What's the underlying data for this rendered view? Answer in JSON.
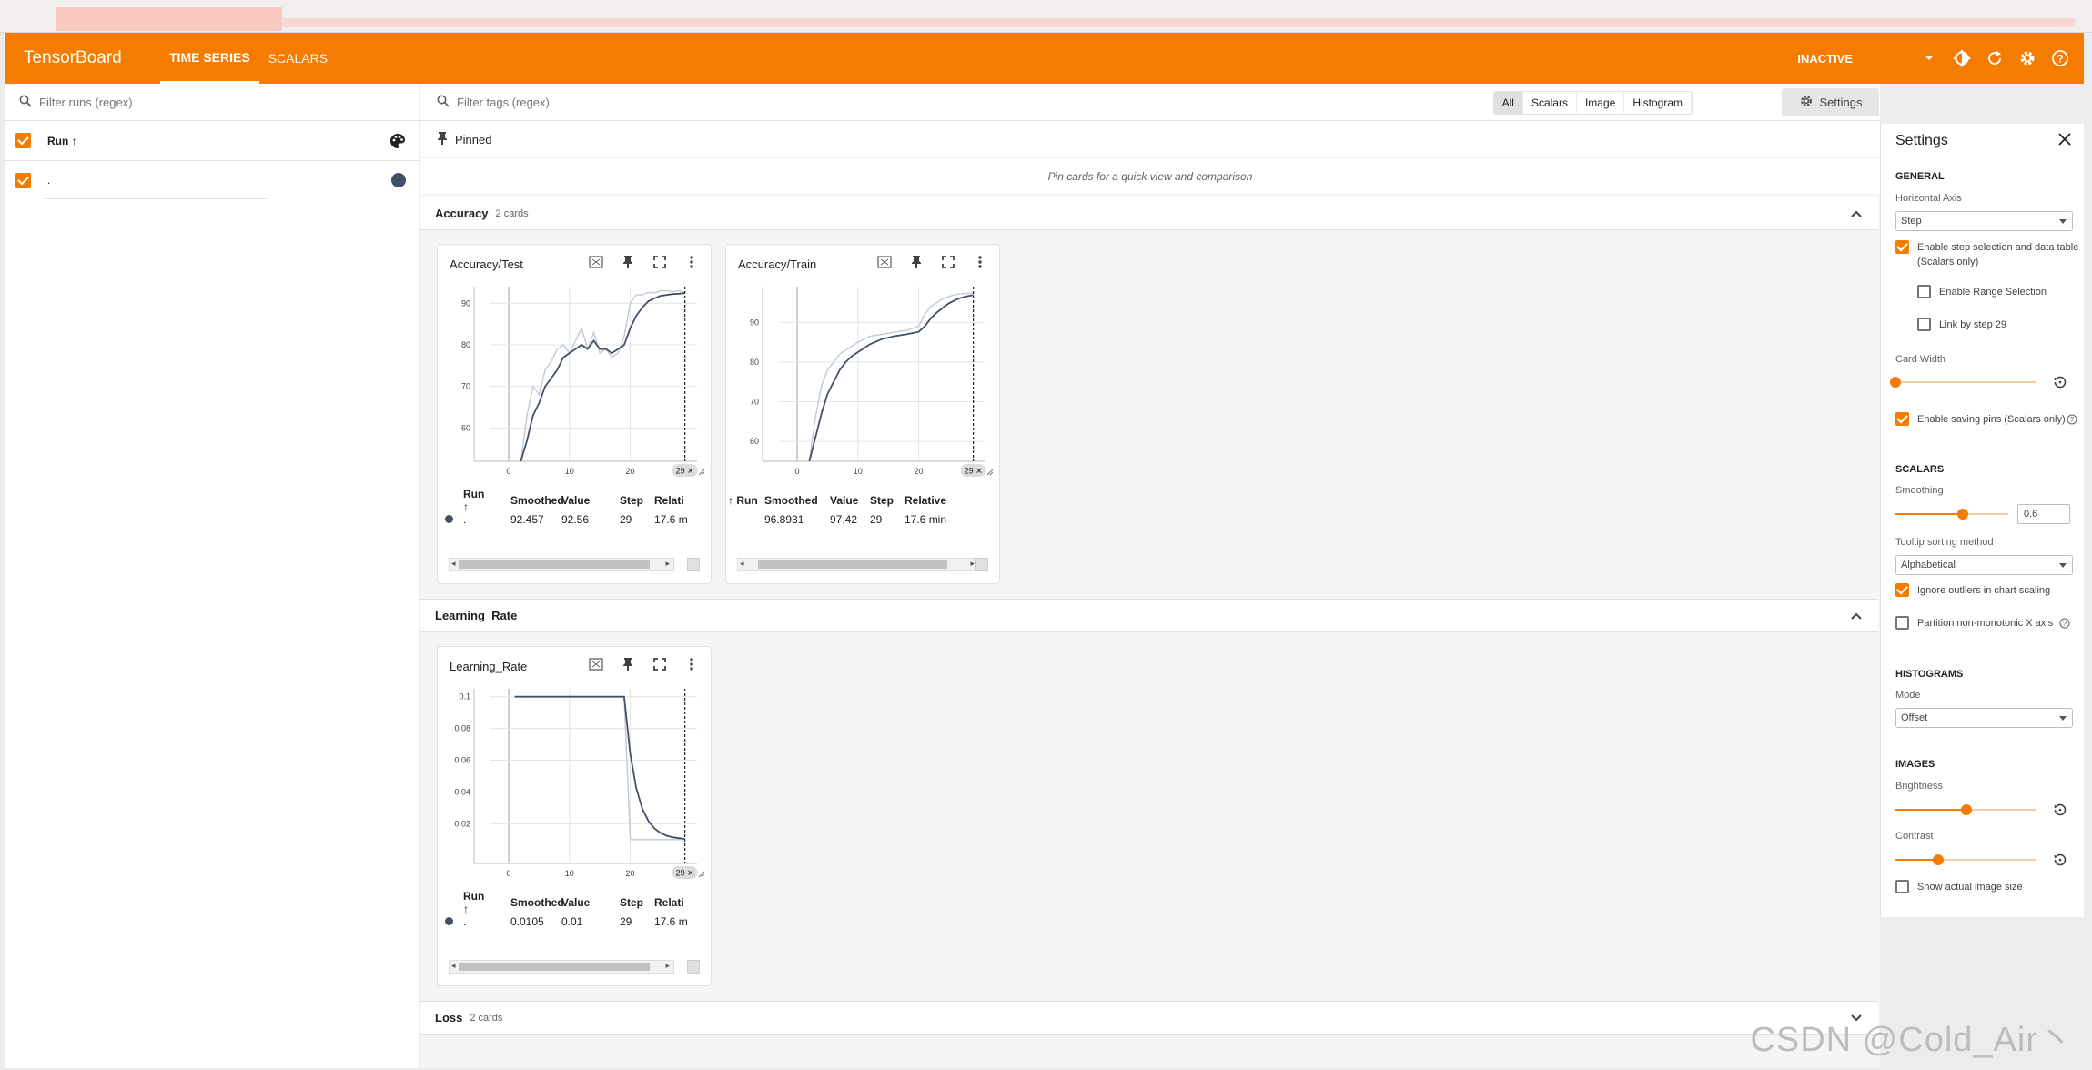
{
  "header": {
    "brand": "TensorBoard",
    "tabs": [
      {
        "label": "TIME SERIES",
        "active": true
      },
      {
        "label": "SCALARS",
        "active": false
      }
    ],
    "status": "INACTIVE",
    "accent_color": "#f57c00",
    "icons": [
      "dropdown-icon",
      "brightness-icon",
      "refresh-icon",
      "settings-gear-icon",
      "help-icon"
    ]
  },
  "sidebar": {
    "filter_placeholder": "Filter runs (regex)",
    "run_column_label": "Run ↑",
    "runs": [
      {
        "name": ".",
        "checked": true,
        "color": "#425066"
      }
    ]
  },
  "main": {
    "filter_placeholder": "Filter tags (regex)",
    "type_filters": [
      "All",
      "Scalars",
      "Image",
      "Histogram"
    ],
    "selected_filter": "All",
    "settings_button": "Settings",
    "pinned_label": "Pinned",
    "pinned_empty": "Pin cards for a quick view and comparison"
  },
  "groups": [
    {
      "name": "Accuracy",
      "count": "2 cards",
      "expanded": true
    },
    {
      "name": "Learning_Rate",
      "count": "",
      "expanded": true
    },
    {
      "name": "Loss",
      "count": "2 cards",
      "expanded": false
    }
  ],
  "cards": [
    {
      "title": "Accuracy/Test",
      "table_headers": [
        "Run ↑",
        "Smoothed",
        "Value",
        "Step",
        "Relati"
      ],
      "row": {
        "run": ".",
        "smoothed": "92.457",
        "value": "92.56",
        "step": "29",
        "relative": "17.6 m"
      },
      "step_marker": "29 ✕"
    },
    {
      "title": "Accuracy/Train",
      "table_headers": [
        "Run ↑",
        "Smoothed",
        "Value",
        "Step",
        "Relative"
      ],
      "row": {
        "run": "",
        "smoothed": "96.8931",
        "value": "97.42",
        "step": "29",
        "relative": "17.6 min"
      },
      "step_marker": "29 ✕"
    },
    {
      "title": "Learning_Rate",
      "table_headers": [
        "Run ↑",
        "Smoothed",
        "Value",
        "Step",
        "Relati"
      ],
      "row": {
        "run": ".",
        "smoothed": "0.0105",
        "value": "0.01",
        "step": "29",
        "relative": "17.6 m"
      },
      "step_marker": "29 ✕"
    }
  ],
  "chart_data": [
    {
      "type": "line",
      "title": "Accuracy/Test",
      "xlim": [
        -3,
        31
      ],
      "ylim": [
        52,
        94
      ],
      "xticks": [
        0,
        10,
        20
      ],
      "yticks": [
        60,
        70,
        80,
        90
      ],
      "series": [
        {
          "name": ".",
          "role": "raw",
          "color": "#c3c9d3",
          "x": [
            2,
            3,
            4,
            5,
            6,
            7,
            8,
            9,
            10,
            11,
            12,
            13,
            14,
            15,
            16,
            17,
            18,
            19,
            20,
            21,
            22,
            23,
            24,
            25,
            26,
            27,
            28,
            29
          ],
          "y": [
            52,
            63,
            70,
            68,
            74,
            76,
            79,
            80,
            78,
            81,
            84,
            79,
            83,
            78,
            79,
            77,
            78,
            82,
            90,
            92,
            92,
            92.6,
            92.5,
            93,
            93,
            92.8,
            93,
            92.56
          ]
        },
        {
          "name": ".",
          "role": "smoothed",
          "color": "#425066",
          "x": [
            2,
            3,
            4,
            5,
            6,
            7,
            8,
            9,
            10,
            11,
            12,
            13,
            14,
            15,
            16,
            17,
            18,
            19,
            20,
            21,
            22,
            23,
            24,
            25,
            26,
            27,
            28,
            29
          ],
          "y": [
            52,
            57,
            63,
            66,
            70,
            72,
            74,
            77,
            78,
            79,
            80,
            79,
            81,
            79,
            79,
            78,
            79,
            80,
            84,
            87,
            89,
            90.5,
            91.2,
            91.8,
            92,
            92.2,
            92.3,
            92.457
          ]
        }
      ]
    },
    {
      "type": "line",
      "title": "Accuracy/Train",
      "xlim": [
        -3,
        31
      ],
      "ylim": [
        55,
        99
      ],
      "xticks": [
        0,
        10,
        20
      ],
      "yticks": [
        60,
        70,
        80,
        90
      ],
      "series": [
        {
          "name": ".",
          "role": "raw",
          "color": "#c3c9d3",
          "x": [
            2,
            3,
            4,
            5,
            6,
            7,
            8,
            9,
            10,
            12,
            14,
            16,
            18,
            20,
            21,
            22,
            23,
            24,
            25,
            26,
            27,
            28,
            29
          ],
          "y": [
            55,
            66,
            74,
            78,
            80,
            82,
            83,
            84,
            85,
            86.5,
            87,
            87.5,
            88,
            89,
            92,
            94,
            95,
            96,
            96.5,
            97,
            97.2,
            97.3,
            97.42
          ]
        },
        {
          "name": ".",
          "role": "smoothed",
          "color": "#425066",
          "x": [
            2,
            3,
            4,
            5,
            6,
            7,
            8,
            9,
            10,
            12,
            14,
            16,
            18,
            20,
            21,
            22,
            23,
            24,
            25,
            26,
            27,
            28,
            29
          ],
          "y": [
            55,
            61,
            67,
            72,
            75,
            78,
            80,
            81.5,
            82.5,
            84.5,
            85.8,
            86.5,
            87,
            87.6,
            89,
            91,
            92.5,
            93.7,
            94.8,
            95.6,
            96.2,
            96.6,
            96.8931
          ]
        }
      ]
    },
    {
      "type": "line",
      "title": "Learning_Rate",
      "xlim": [
        -3,
        31
      ],
      "ylim": [
        -0.005,
        0.105
      ],
      "xticks": [
        0,
        10,
        20
      ],
      "yticks": [
        0.02,
        0.04,
        0.06,
        0.08,
        0.1
      ],
      "series": [
        {
          "name": ".",
          "role": "raw",
          "color": "#c3c9d3",
          "x": [
            1,
            19,
            20,
            29
          ],
          "y": [
            0.1,
            0.1,
            0.01,
            0.01
          ]
        },
        {
          "name": ".",
          "role": "smoothed",
          "color": "#425066",
          "x": [
            1,
            19,
            20,
            21,
            22,
            23,
            24,
            25,
            26,
            27,
            28,
            29
          ],
          "y": [
            0.1,
            0.1,
            0.064,
            0.0424,
            0.0294,
            0.0217,
            0.017,
            0.0142,
            0.0125,
            0.0115,
            0.0109,
            0.0105
          ]
        }
      ]
    }
  ],
  "settings_panel": {
    "title": "Settings",
    "general_label": "GENERAL",
    "horizontal_axis_label": "Horizontal Axis",
    "horizontal_axis_value": "Step",
    "step_selection_label": "Enable step selection and data table",
    "step_selection_note": "(Scalars only)",
    "range_selection_label": "Enable Range Selection",
    "link_step_label": "Link by step 29",
    "card_width_label": "Card Width",
    "saving_pins_label": "Enable saving pins (Scalars only)",
    "scalars_label": "SCALARS",
    "smoothing_label": "Smoothing",
    "smoothing_value": "0.6",
    "tooltip_sort_label": "Tooltip sorting method",
    "tooltip_sort_value": "Alphabetical",
    "ignore_outliers_label": "Ignore outliers in chart scaling",
    "partition_label": "Partition non-monotonic X axis",
    "histograms_label": "HISTOGRAMS",
    "mode_label": "Mode",
    "mode_value": "Offset",
    "images_label": "IMAGES",
    "brightness_label": "Brightness",
    "contrast_label": "Contrast",
    "actual_size_label": "Show actual image size",
    "card_width_level": 0.0,
    "smoothing_level": 0.6,
    "brightness_level": 0.5,
    "contrast_level": 0.3
  },
  "watermark": "CSDN @Cold_Air丶"
}
